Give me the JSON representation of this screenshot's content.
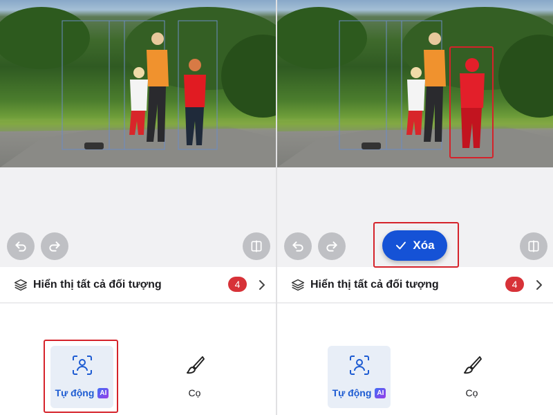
{
  "toolbar": {
    "objects_label": "Hiển thị tất cả đối tượng",
    "object_count": "4"
  },
  "actions": {
    "delete_label": "Xóa"
  },
  "tools": {
    "auto_label": "Tự động",
    "ai_badge": "AI",
    "brush_label": "Cọ"
  },
  "icons": {
    "undo": "undo-icon",
    "redo": "redo-icon",
    "compare": "compare-icon",
    "layers": "layers-icon",
    "chevron": "chevron-right-icon",
    "auto": "person-scan-icon",
    "brush": "brush-icon",
    "check": "check-icon"
  },
  "colors": {
    "accent": "#1552d6",
    "badge": "#d73238",
    "highlight": "#d5222a",
    "selected_person": "#e31f2a"
  }
}
